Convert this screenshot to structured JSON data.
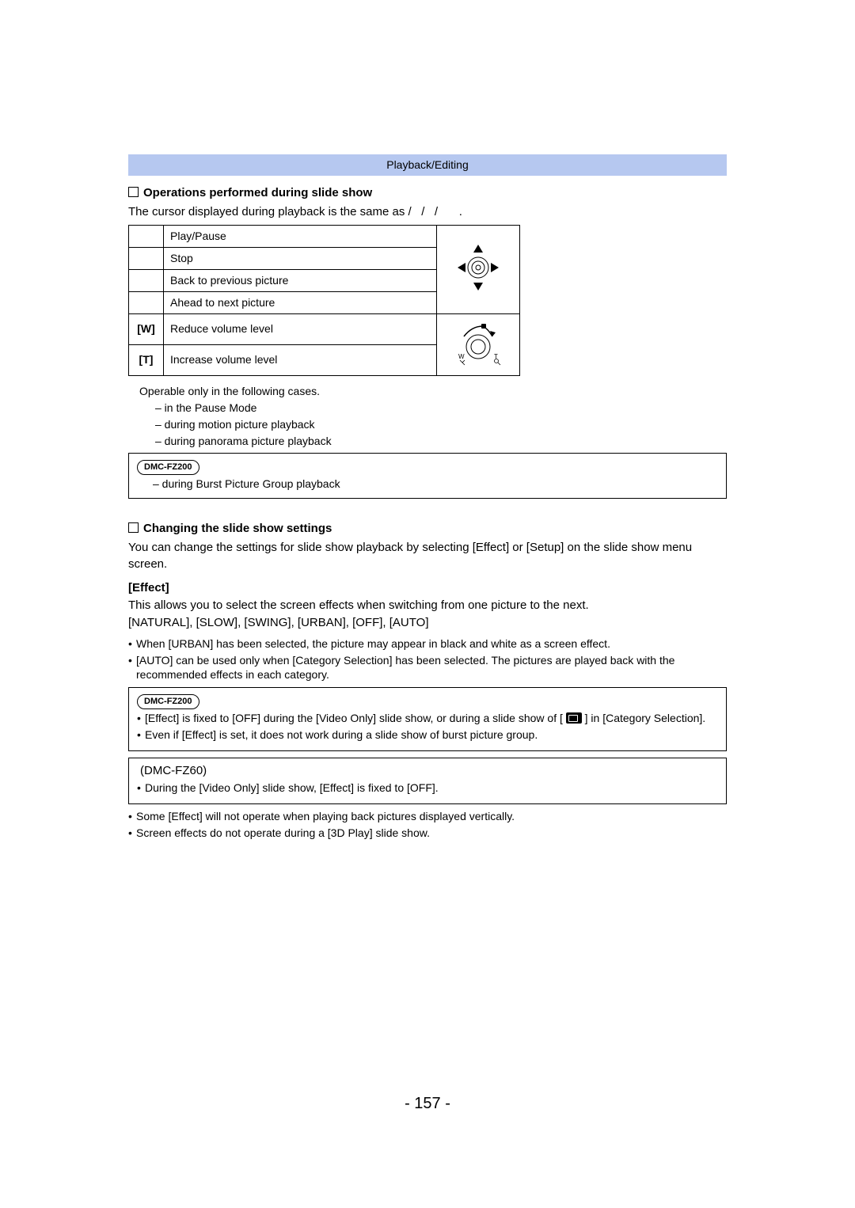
{
  "header": "Playback/Editing",
  "ops": {
    "heading": "Operations performed during slide show",
    "intro_a": "The cursor displayed during playback is the same as ",
    "intro_b": "/",
    "intro_c": "/",
    "intro_d": "/",
    "intro_e": ".",
    "rows": [
      {
        "key": "",
        "desc": "Play/Pause"
      },
      {
        "key": "",
        "desc": "Stop"
      },
      {
        "key": "",
        "desc": "Back to previous picture"
      },
      {
        "key": "",
        "desc": "Ahead to next picture"
      },
      {
        "key": "[W]",
        "desc": "Reduce volume level"
      },
      {
        "key": "[T]",
        "desc": "Increase volume level"
      }
    ],
    "notes": {
      "lead": "Operable only in the following cases.",
      "sub1": "– in the Pause Mode",
      "sub2": "– during motion picture playback",
      "sub3": "– during panorama picture playback"
    },
    "model_box": {
      "tag": "DMC-FZ200",
      "line": "– during Burst Picture Group playback"
    }
  },
  "settings": {
    "heading": "Changing the slide show settings",
    "intro": "You can change the settings for slide show playback by selecting [Effect] or [Setup] on the slide show menu screen.",
    "effect_heading": "[Effect]",
    "effect_desc": "This allows you to select the screen effects when switching from one picture to the next.",
    "effect_opts": "[NATURAL], [SLOW], [SWING], [URBAN], [OFF], [AUTO]",
    "bullets_a": [
      "When [URBAN] has been selected, the picture may appear in black and white as a screen effect.",
      "[AUTO] can be used only when [Category Selection] has been selected. The pictures are played back with the recommended effects in each category."
    ],
    "box_fz200": {
      "tag": "DMC-FZ200",
      "line1a": "[Effect] is fixed to [OFF] during the [Video Only] slide show, or during a slide show of [",
      "line1b": "] in [Category Selection].",
      "line2": "Even if [Effect] is set, it does not work during a slide show of burst picture group."
    },
    "box_fz60": {
      "tag": "(DMC-FZ60)",
      "line1": "During the [Video Only] slide show, [Effect] is fixed to [OFF]."
    },
    "bullets_b": [
      "Some [Effect] will not operate when playing back pictures displayed vertically.",
      "Screen effects do not operate during a [3D Play] slide show."
    ]
  },
  "page_number": "- 157 -"
}
